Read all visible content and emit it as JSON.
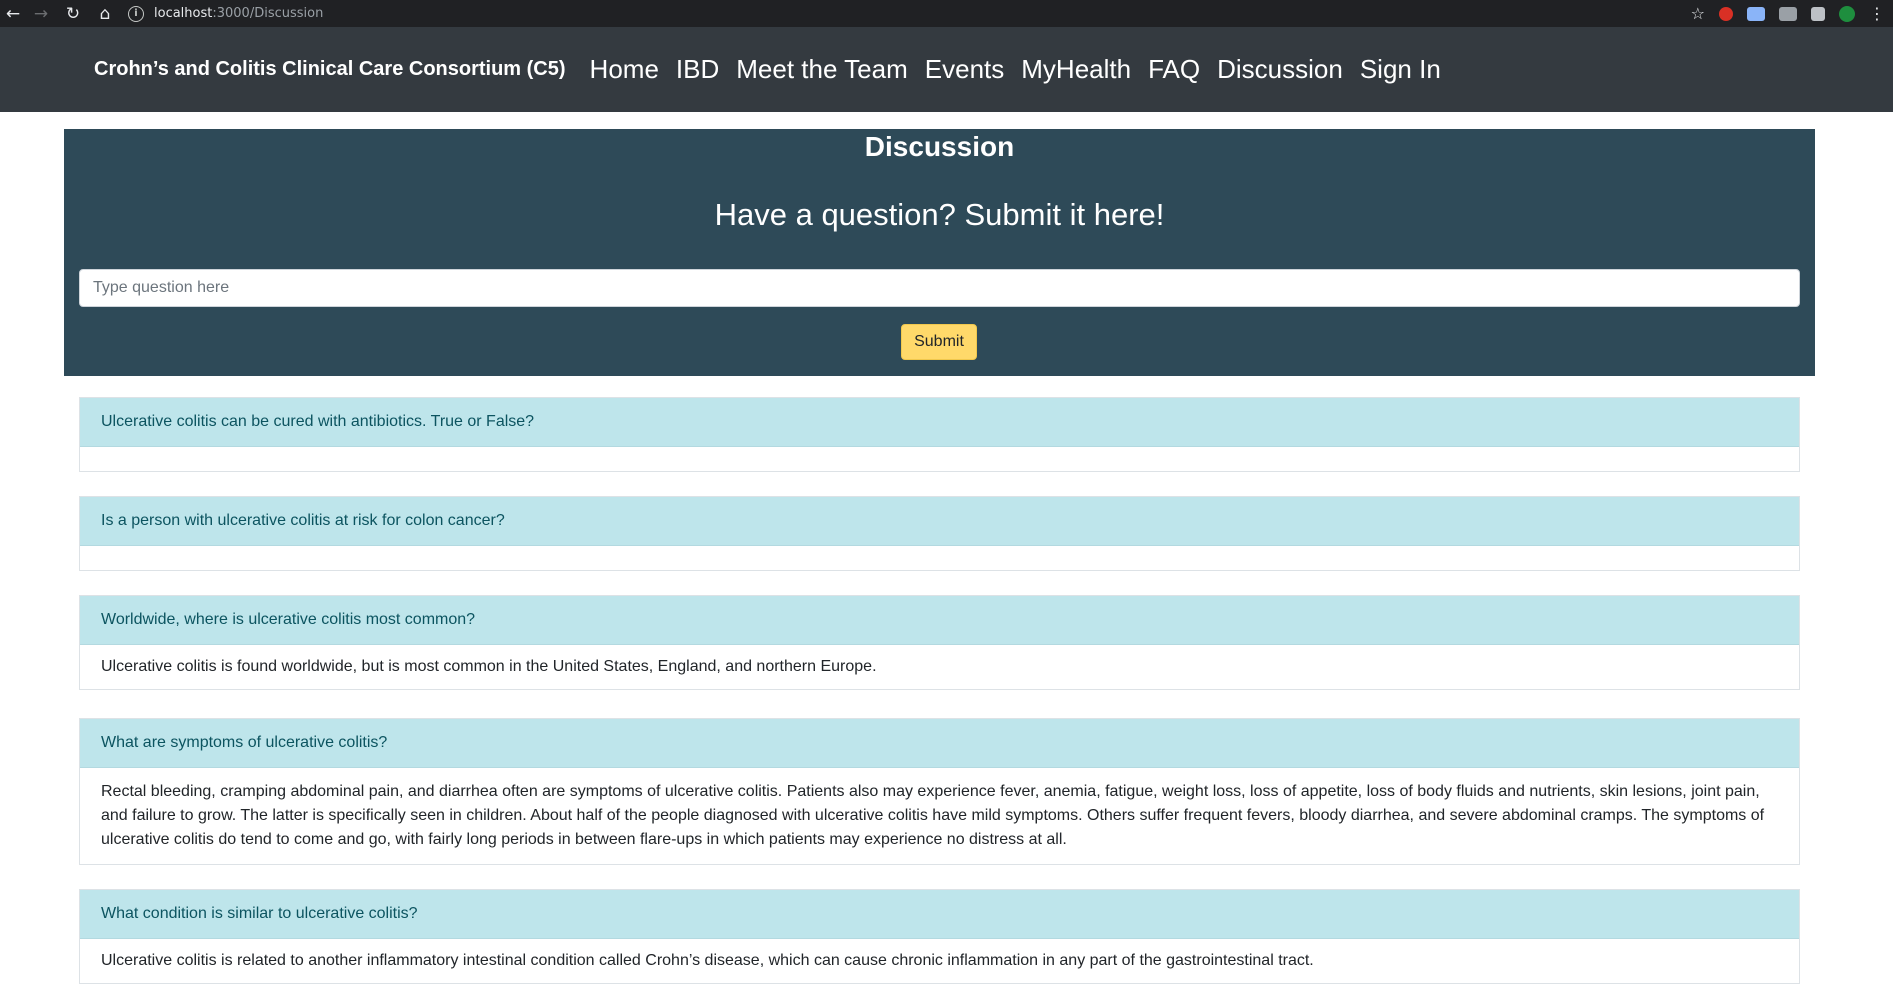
{
  "browser": {
    "url_host": "localhost",
    "url_path": ":3000/Discussion"
  },
  "navbar": {
    "brand": "Crohn’s and Colitis Clinical Care Consortium (C5)",
    "links": [
      "Home",
      "IBD",
      "Meet the Team",
      "Events",
      "MyHealth",
      "FAQ",
      "Discussion",
      "Sign In"
    ]
  },
  "hero": {
    "title": "Discussion",
    "subtitle": "Have a question? Submit it here!",
    "input_placeholder": "Type question here",
    "submit_label": "Submit"
  },
  "questions": [
    {
      "question": "Ulcerative colitis can be cured with antibiotics. True or False?",
      "answer": ""
    },
    {
      "question": "Is a person with ulcerative colitis at risk for colon cancer?",
      "answer": ""
    },
    {
      "question": "Worldwide, where is ulcerative colitis most common?",
      "answer": "Ulcerative colitis is found worldwide, but is most common in the United States, England, and northern Europe."
    },
    {
      "question": "What are symptoms of ulcerative colitis?",
      "answer": "Rectal bleeding, cramping abdominal pain, and diarrhea often are symptoms of ulcerative colitis. Patients also may experience fever, anemia, fatigue, weight loss, loss of appetite, loss of body fluids and nutrients, skin lesions, joint pain, and failure to grow. The latter is specifically seen in children. About half of the people diagnosed with ulcerative colitis have mild symptoms. Others suffer frequent fevers, bloody diarrhea, and severe abdominal cramps. The symptoms of ulcerative colitis do tend to come and go, with fairly long periods in between flare-ups in which patients may experience no distress at all."
    },
    {
      "question": "What condition is similar to ulcerative colitis?",
      "answer": "Ulcerative colitis is related to another inflammatory intestinal condition called Crohn’s disease, which can cause chronic inflammation in any part of the gastrointestinal tract."
    }
  ],
  "colors": {
    "navbar_bg": "#343a40",
    "hero_bg": "#2e4a58",
    "card_header_bg": "#bee5eb",
    "submit_bg": "#ffd96a"
  }
}
